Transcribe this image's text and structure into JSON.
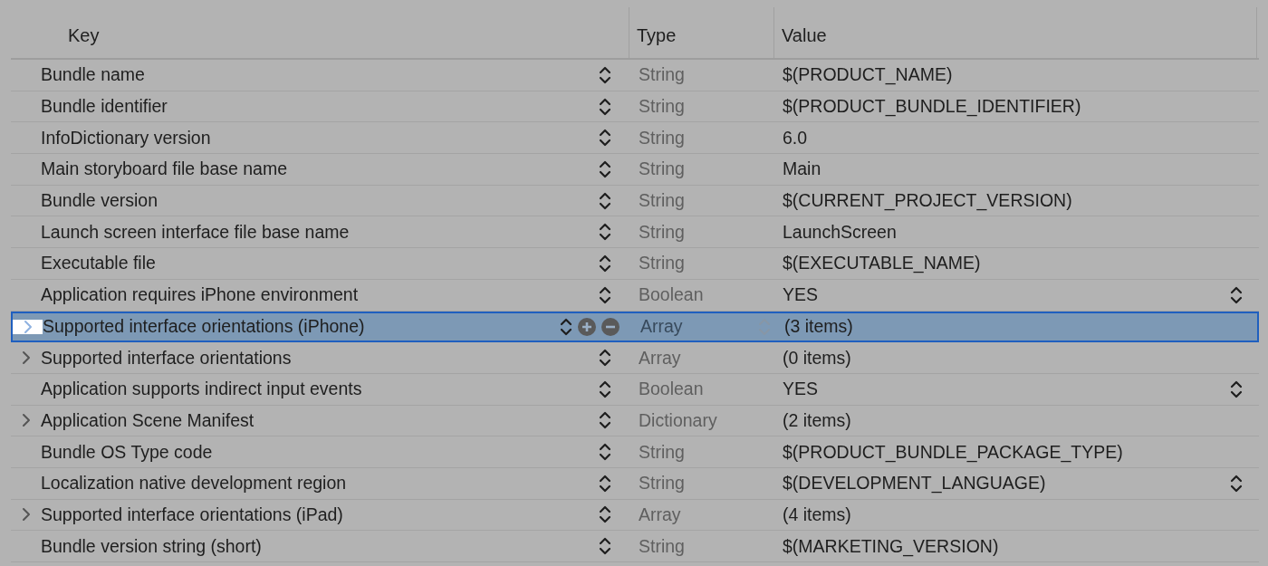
{
  "columns": [
    "Key",
    "Type",
    "Value"
  ],
  "rows": [
    {
      "key": "Bundle name",
      "type": "String",
      "value": "$(PRODUCT_NAME)",
      "expandable": false,
      "selected": false,
      "value_menu": false
    },
    {
      "key": "Bundle identifier",
      "type": "String",
      "value": "$(PRODUCT_BUNDLE_IDENTIFIER)",
      "expandable": false,
      "selected": false,
      "value_menu": false
    },
    {
      "key": "InfoDictionary version",
      "type": "String",
      "value": "6.0",
      "expandable": false,
      "selected": false,
      "value_menu": false
    },
    {
      "key": "Main storyboard file base name",
      "type": "String",
      "value": "Main",
      "expandable": false,
      "selected": false,
      "value_menu": false
    },
    {
      "key": "Bundle version",
      "type": "String",
      "value": "$(CURRENT_PROJECT_VERSION)",
      "expandable": false,
      "selected": false,
      "value_menu": false
    },
    {
      "key": "Launch screen interface file base name",
      "type": "String",
      "value": "LaunchScreen",
      "expandable": false,
      "selected": false,
      "value_menu": false
    },
    {
      "key": "Executable file",
      "type": "String",
      "value": "$(EXECUTABLE_NAME)",
      "expandable": false,
      "selected": false,
      "value_menu": false
    },
    {
      "key": "Application requires iPhone environment",
      "type": "Boolean",
      "value": "YES",
      "expandable": false,
      "selected": false,
      "value_menu": true
    },
    {
      "key": "Supported interface orientations (iPhone)",
      "type": "Array",
      "value": "(3 items)",
      "expandable": true,
      "selected": true,
      "value_menu": false
    },
    {
      "key": "Supported interface orientations",
      "type": "Array",
      "value": "(0 items)",
      "expandable": true,
      "selected": false,
      "value_menu": false
    },
    {
      "key": "Application supports indirect input events",
      "type": "Boolean",
      "value": "YES",
      "expandable": false,
      "selected": false,
      "value_menu": true
    },
    {
      "key": "Application Scene Manifest",
      "type": "Dictionary",
      "value": "(2 items)",
      "expandable": true,
      "selected": false,
      "value_menu": false
    },
    {
      "key": "Bundle OS Type code",
      "type": "String",
      "value": "$(PRODUCT_BUNDLE_PACKAGE_TYPE)",
      "expandable": false,
      "selected": false,
      "value_menu": false
    },
    {
      "key": "Localization native development region",
      "type": "String",
      "value": "$(DEVELOPMENT_LANGUAGE)",
      "expandable": false,
      "selected": false,
      "value_menu": true
    },
    {
      "key": "Supported interface orientations (iPad)",
      "type": "Array",
      "value": "(4 items)",
      "expandable": true,
      "selected": false,
      "value_menu": false
    },
    {
      "key": "Bundle version string (short)",
      "type": "String",
      "value": "$(MARKETING_VERSION)",
      "expandable": false,
      "selected": false,
      "value_menu": false
    }
  ]
}
